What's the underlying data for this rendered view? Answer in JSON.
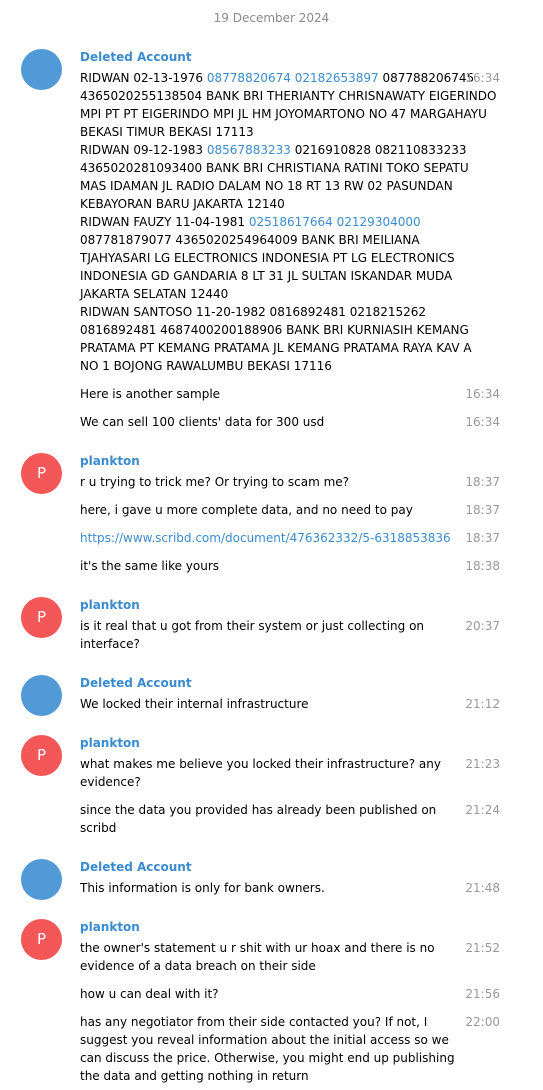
{
  "date_header": "19 December 2024",
  "colors": {
    "link": "#3a8bd0",
    "name": "#3a8bd0",
    "avatar_deleted": "#529ad7",
    "avatar_plankton": "#f35757",
    "time": "#999999"
  },
  "groups": [
    {
      "sender": "Deleted Account",
      "avatar_letter": "",
      "avatar_color": "#529ad7",
      "messages": [
        {
          "time": "16:34",
          "lines": [
            [
              {
                "t": "RIDWAN  02-13-1976  "
              },
              {
                "t": "08778820674",
                "link": true
              },
              {
                "t": "  "
              },
              {
                "t": "02182653897",
                "link": true
              },
              {
                "t": "  087788206745"
              }
            ],
            [
              {
                "t": "4365020255138504  BANK BRI  THERIANTY CHRISNAWATY  EIGERINDO"
              }
            ],
            [
              {
                "t": "MPI PT  PT EIGERINDO MPI  JL HM JOYOMARTONO NO 47  MARGAHAYU"
              }
            ],
            [
              {
                "t": "BEKASI TIMUR  BEKASI  17113"
              }
            ],
            [
              {
                "t": "RIDWAN  09-12-1983  "
              },
              {
                "t": "08567883233",
                "link": true
              },
              {
                "t": "  0216910828  082110833233"
              }
            ],
            [
              {
                "t": "4365020281093400  BANK BRI  CHRISTIANA RATINI  TOKO SEPATU"
              }
            ],
            [
              {
                "t": "MAS IDAMAN  JL RADIO DALAM NO 18  RT 13 RW 02 PASUNDAN"
              }
            ],
            [
              {
                "t": "KEBAYORAN BARU  JAKARTA  12140"
              }
            ],
            [
              {
                "t": "RIDWAN FAUZY  11-04-1981  "
              },
              {
                "t": "02518617664",
                "link": true
              },
              {
                "t": "  "
              },
              {
                "t": "02129304000",
                "link": true
              }
            ],
            [
              {
                "t": "087781879077  4365020254964009  BANK BRI  MEILIANA"
              }
            ],
            [
              {
                "t": "TJAHYASARI  LG ELECTRONICS INDONESIA PT  LG ELECTRONICS"
              }
            ],
            [
              {
                "t": "INDONESIA  GD GANDARIA 8 LT 31  JL SULTAN ISKANDAR MUDA"
              }
            ],
            [
              {
                "t": "JAKARTA SELATAN  12440"
              }
            ],
            [
              {
                "t": "RIDWAN SANTOSO  11-20-1982  0816892481  0218215262"
              }
            ],
            [
              {
                "t": "0816892481  4687400200188906  BANK BRI  KURNIASIH  KEMANG"
              }
            ],
            [
              {
                "t": "PRATAMA PT  KEMANG PRATAMA  JL KEMANG PRATAMA RAYA KAV A"
              }
            ],
            [
              {
                "t": "NO 1 BOJONG RAWALUMBU  BEKASI  17116"
              }
            ]
          ]
        },
        {
          "time": "16:34",
          "text": "Here is another sample"
        },
        {
          "time": "16:34",
          "text": "We can sell 100 clients' data for 300 usd"
        }
      ]
    },
    {
      "sender": "plankton",
      "avatar_letter": "P",
      "avatar_color": "#f35757",
      "messages": [
        {
          "time": "18:37",
          "text": "r u trying to trick me? Or trying to scam me?"
        },
        {
          "time": "18:37",
          "text": "here, i gave u more complete data, and no need to pay"
        },
        {
          "time": "18:37",
          "text": "https://www.scribd.com/document/476362332/5-6318853836",
          "link": true
        },
        {
          "time": "18:38",
          "text": "it's the same like yours"
        }
      ]
    },
    {
      "sender": "plankton",
      "avatar_letter": "P",
      "avatar_color": "#f35757",
      "messages": [
        {
          "time": "20:37",
          "text": "is it real that u got from their system or just collecting on interface?"
        }
      ]
    },
    {
      "sender": "Deleted Account",
      "avatar_letter": "",
      "avatar_color": "#529ad7",
      "messages": [
        {
          "time": "21:12",
          "text": "We locked their internal infrastructure"
        }
      ]
    },
    {
      "sender": "plankton",
      "avatar_letter": "P",
      "avatar_color": "#f35757",
      "messages": [
        {
          "time": "21:23",
          "text": "what makes me believe you locked their infrastructure? any evidence?"
        },
        {
          "time": "21:24",
          "text": "since the data you provided has already been published on scribd"
        }
      ]
    },
    {
      "sender": "Deleted Account",
      "avatar_letter": "",
      "avatar_color": "#529ad7",
      "messages": [
        {
          "time": "21:48",
          "text": "This information is only for bank owners."
        }
      ]
    },
    {
      "sender": "plankton",
      "avatar_letter": "P",
      "avatar_color": "#f35757",
      "messages": [
        {
          "time": "21:52",
          "text": "the owner's statement u r shit with ur hoax and there is no evidence of a data breach on their side"
        },
        {
          "time": "21:56",
          "text": "how u can deal with it?"
        },
        {
          "time": "22:00",
          "text": "has any negotiator from their side contacted you? If not, I suggest you reveal information about the initial access so we can discuss the price. Otherwise, you might end up publishing the data and getting nothing in return"
        }
      ]
    }
  ]
}
